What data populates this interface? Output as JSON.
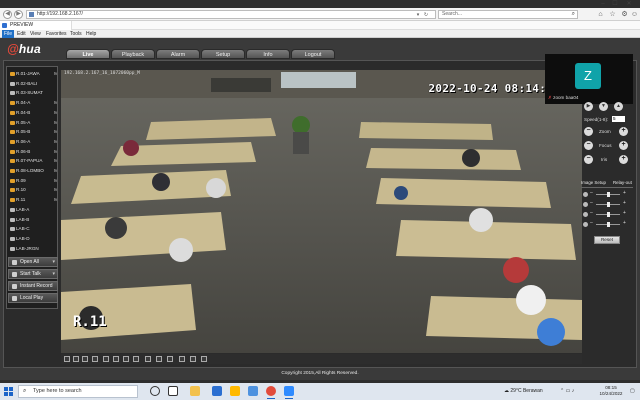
{
  "browser": {
    "url": "http://192.168.2.167/",
    "search_placeholder": "Search...",
    "tab_title": "PREVIEW",
    "menu": [
      "File",
      "Edit",
      "View",
      "Favorites",
      "Tools",
      "Help"
    ]
  },
  "app": {
    "logo_text": "hua",
    "nav_tabs": [
      "Live",
      "Playback",
      "Alarm",
      "Setup",
      "Info",
      "Logout"
    ],
    "active_tab": "Live",
    "channels": [
      {
        "label": "R.01-JAWA",
        "on": true
      },
      {
        "label": "R.02-BALI",
        "on": false
      },
      {
        "label": "R.03-SUMAT",
        "on": false
      },
      {
        "label": "R.04-A",
        "on": true
      },
      {
        "label": "R.04-B",
        "on": true
      },
      {
        "label": "R.05-A",
        "on": true
      },
      {
        "label": "R.05-B",
        "on": true
      },
      {
        "label": "R.06-A",
        "on": true
      },
      {
        "label": "R.06-B",
        "on": true
      },
      {
        "label": "R.07-PAPUA",
        "on": true
      },
      {
        "label": "R.08-LOMBO",
        "on": true
      },
      {
        "label": "R.09",
        "on": true
      },
      {
        "label": "R.10",
        "on": true
      },
      {
        "label": "R.11",
        "on": true
      },
      {
        "label": "LAB-A",
        "on": false
      },
      {
        "label": "LAB-B",
        "on": false
      },
      {
        "label": "LAB-C",
        "on": false
      },
      {
        "label": "LAB-D",
        "on": false
      },
      {
        "label": "LAB-JRGN",
        "on": false
      }
    ],
    "channel_marker": "M",
    "controls": {
      "open_all": "Open All",
      "start_talk": "Start Talk",
      "instant_record": "Instant Record",
      "local_play": "Local Play"
    },
    "video": {
      "osd_info": "192.168.2.167_16_1072060pp_M",
      "osd_datetime": "2022-10-24 08:14:32",
      "osd_channel": "R.11"
    },
    "zoom": {
      "initial": "Z",
      "name": "zoom baa04"
    },
    "ptz": {
      "speed_label": "Speed(1-8):",
      "speed_value": "5",
      "zoom_label": "Zoom",
      "focus_label": "Focus",
      "iris_label": "Iris",
      "plus": "+",
      "minus": "−"
    },
    "image_setup": {
      "header_left": "Image Setup",
      "header_right": "Relay-out",
      "reset": "Reset",
      "slider_levels": [
        0.5,
        0.5,
        0.5,
        0.5
      ]
    },
    "copyright": "Copyright 2015,All Rights Reserved."
  },
  "taskbar": {
    "search_placeholder": "Type here to search",
    "weather": "29°C  Berawan",
    "time": "08:15",
    "date": "10/24/2022"
  }
}
